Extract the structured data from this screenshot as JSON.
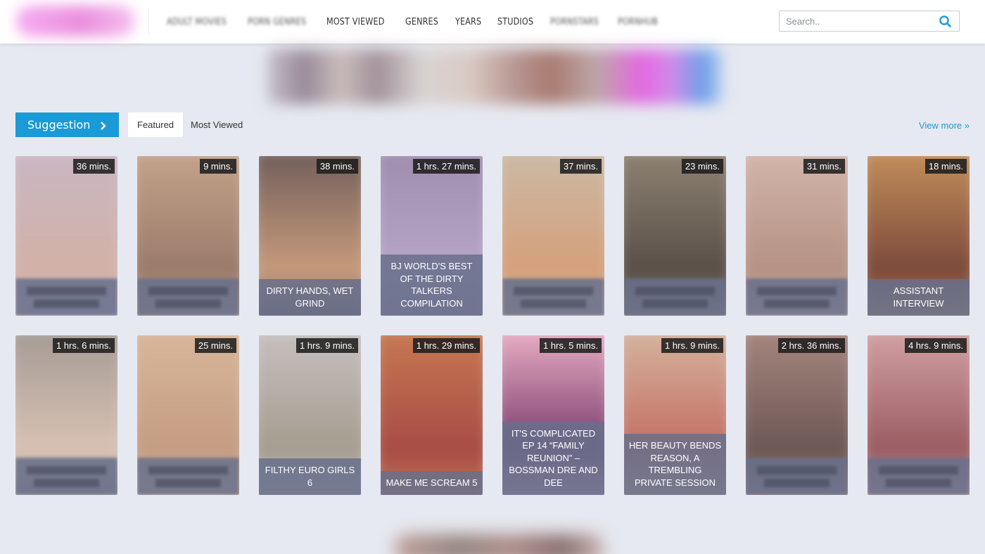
{
  "header": {
    "nav": [
      {
        "label": "ADULT MOVIES",
        "blurred": true
      },
      {
        "label": "PORN GENRES",
        "blurred": true
      },
      {
        "label": "MOST VIEWED",
        "blurred": false
      },
      {
        "label": "GENRES",
        "blurred": false
      },
      {
        "label": "YEARS",
        "blurred": false
      },
      {
        "label": "STUDIOS",
        "blurred": false
      },
      {
        "label": "PORNSTARS",
        "blurred": true
      },
      {
        "label": "PORNHUB",
        "blurred": true
      }
    ],
    "search": {
      "placeholder": "Search..",
      "value": ""
    }
  },
  "suggestion": {
    "button_label": "Suggestion",
    "tabs": [
      {
        "label": "Featured",
        "active": true
      },
      {
        "label": "Most Viewed",
        "active": false
      }
    ],
    "view_more": "View more »"
  },
  "videos": [
    {
      "duration": "36 mins.",
      "title": "",
      "title_blurred": true,
      "colors": [
        "#c9b7c4",
        "#d2b1a6"
      ]
    },
    {
      "duration": "9 mins.",
      "title": "",
      "title_blurred": true,
      "colors": [
        "#c6a48c",
        "#9a7b6a"
      ]
    },
    {
      "duration": "38 mins.",
      "title": "DIRTY HANDS, WET GRIND",
      "title_blurred": false,
      "colors": [
        "#6f5d59",
        "#c79b7c"
      ]
    },
    {
      "duration": "1 hrs. 27 mins.",
      "title": "BJ WORLD'S BEST OF THE DIRTY TALKERS COMPILATION",
      "title_blurred": false,
      "colors": [
        "#9f8cae",
        "#b7a6c6"
      ]
    },
    {
      "duration": "37 mins.",
      "title": "",
      "title_blurred": true,
      "colors": [
        "#cbbaa6",
        "#d5a07a"
      ]
    },
    {
      "duration": "23 mins.",
      "title": "",
      "title_blurred": true,
      "colors": [
        "#8f8373",
        "#5a4f48"
      ]
    },
    {
      "duration": "31 mins.",
      "title": "",
      "title_blurred": true,
      "colors": [
        "#d3b6ac",
        "#b59184"
      ]
    },
    {
      "duration": "18 mins.",
      "title": "ASSISTANT INTERVIEW",
      "title_blurred": false,
      "colors": [
        "#c48f5c",
        "#7c4a3b"
      ]
    },
    {
      "duration": "1 hrs. 6 mins.",
      "title": "",
      "title_blurred": true,
      "colors": [
        "#a49a94",
        "#d8c2b3"
      ]
    },
    {
      "duration": "25 mins.",
      "title": "",
      "title_blurred": true,
      "colors": [
        "#d9b79a",
        "#c49c82"
      ]
    },
    {
      "duration": "1 hrs. 9 mins.",
      "title": "FILTHY EURO GIRLS 6",
      "title_blurred": false,
      "colors": [
        "#c7c1c0",
        "#a69d90"
      ]
    },
    {
      "duration": "1 hrs. 29 mins.",
      "title": "MAKE ME SCREAM 5",
      "title_blurred": false,
      "colors": [
        "#c77a52",
        "#a94c45"
      ]
    },
    {
      "duration": "1 hrs. 5 mins.",
      "title": "IT'S COMPLICATED EP 14 “FAMILY REUNION” – BOSSMAN DRE AND DEE",
      "title_blurred": false,
      "colors": [
        "#eab0c5",
        "#7a3b6c"
      ]
    },
    {
      "duration": "1 hrs. 9 mins.",
      "title": "HER BEAUTY BENDS REASON, A TREMBLING PRIVATE SESSION",
      "title_blurred": false,
      "colors": [
        "#d5b59f",
        "#c36e63"
      ]
    },
    {
      "duration": "2 hrs. 36 mins.",
      "title": "",
      "title_blurred": true,
      "colors": [
        "#a6877f",
        "#6d5755"
      ]
    },
    {
      "duration": "4 hrs. 9 mins.",
      "title": "",
      "title_blurred": true,
      "colors": [
        "#d3a3a4",
        "#9a5b63"
      ]
    }
  ]
}
